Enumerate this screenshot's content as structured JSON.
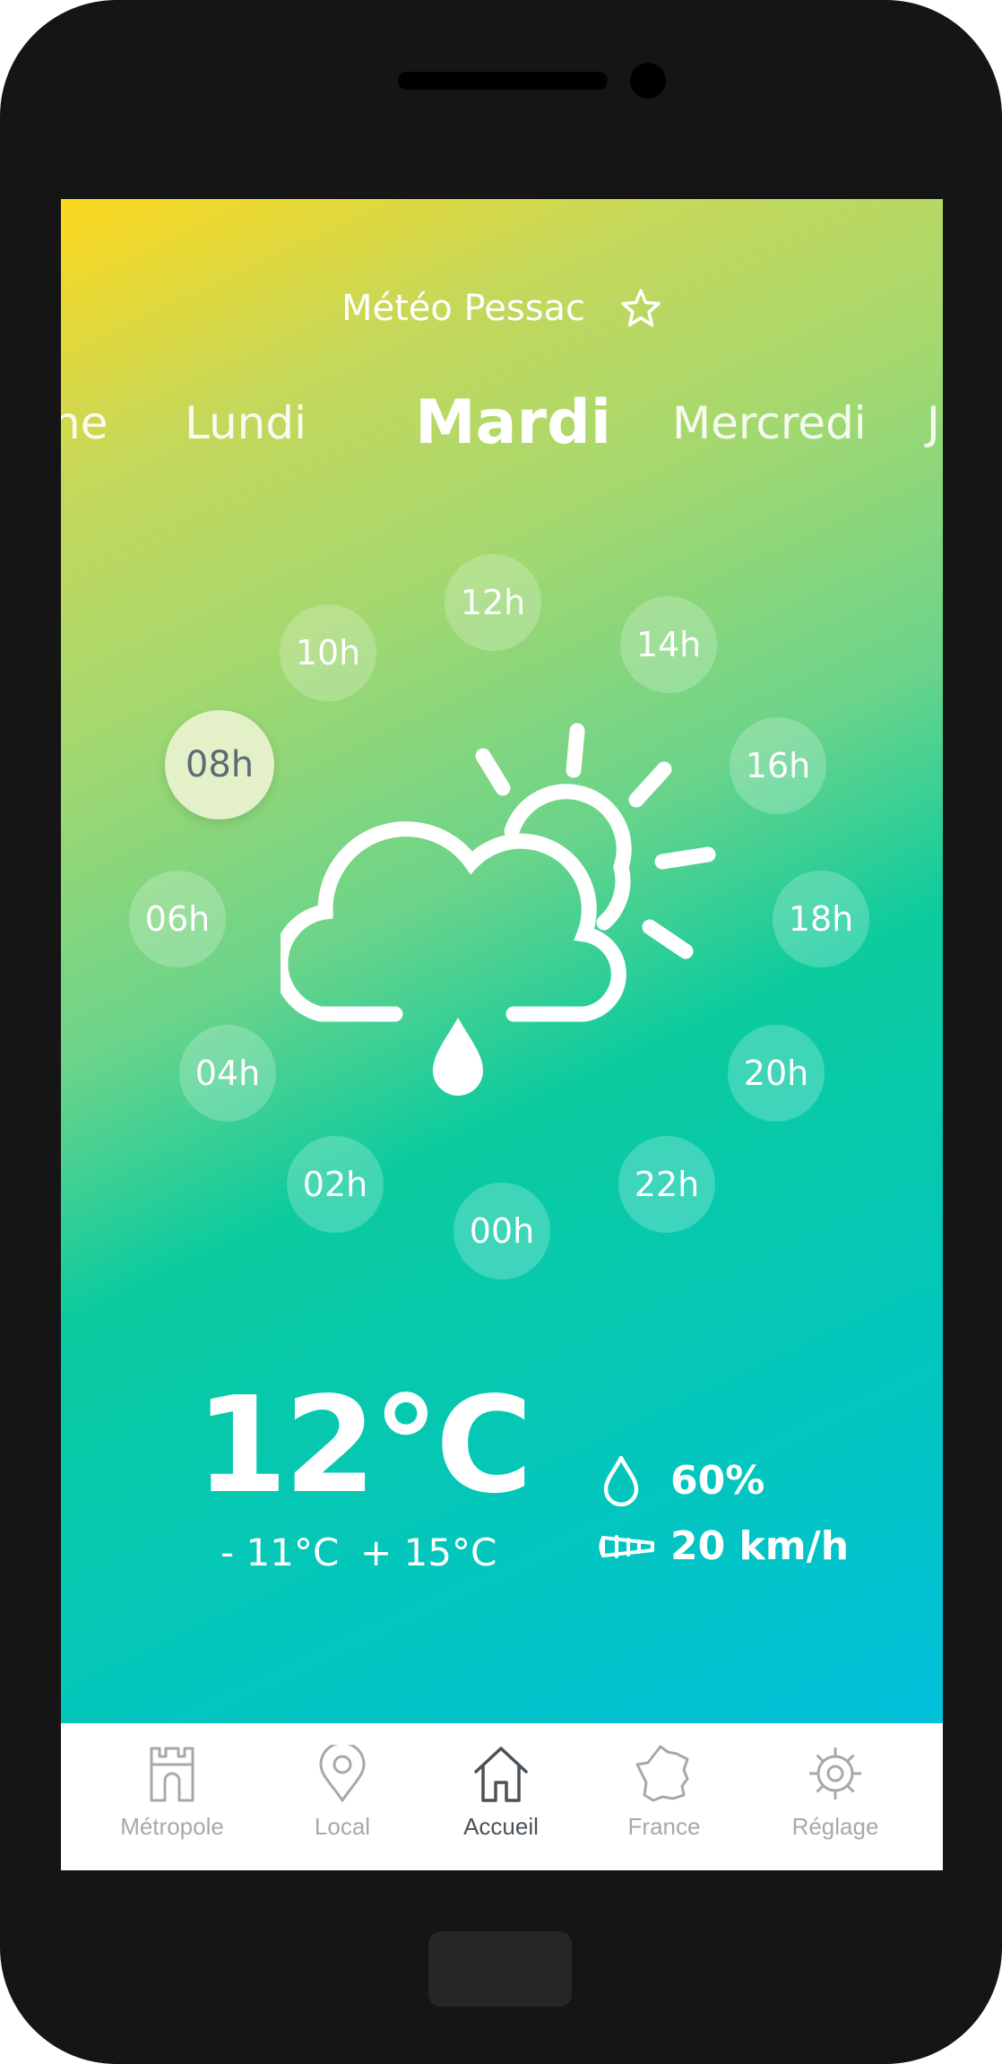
{
  "header": {
    "title": "Météo Pessac",
    "favorite_icon": "star-outline-icon"
  },
  "days": [
    {
      "label": "he",
      "active": false
    },
    {
      "label": "Lundi",
      "active": false
    },
    {
      "label": "Mardi",
      "active": true
    },
    {
      "label": "Mercredi",
      "active": false
    },
    {
      "label": "J",
      "active": false
    }
  ],
  "hours": [
    "12h",
    "14h",
    "16h",
    "18h",
    "20h",
    "22h",
    "00h",
    "02h",
    "04h",
    "06h",
    "08h",
    "10h"
  ],
  "selected_hour": "08h",
  "weather": {
    "condition_icon": "sun-cloud-rain-icon",
    "temperature": "12°C",
    "min": "- 11°C",
    "max": "+ 15°C",
    "humidity": "60%",
    "wind": "20 km/h"
  },
  "nav": [
    {
      "label": "Métropole",
      "icon": "castle-tower-icon",
      "active": false
    },
    {
      "label": "Local",
      "icon": "map-pin-icon",
      "active": false
    },
    {
      "label": "Accueil",
      "icon": "home-icon",
      "active": true
    },
    {
      "label": "France",
      "icon": "france-map-icon",
      "active": false
    },
    {
      "label": "Réglage",
      "icon": "gear-icon",
      "active": false
    }
  ],
  "colors": {
    "gradient_top": "#fcd81e",
    "gradient_mid": "#0ccb9e",
    "gradient_bottom": "#00c0db",
    "nav_active": "#4a5157",
    "nav_inactive": "#a5a9ad"
  }
}
